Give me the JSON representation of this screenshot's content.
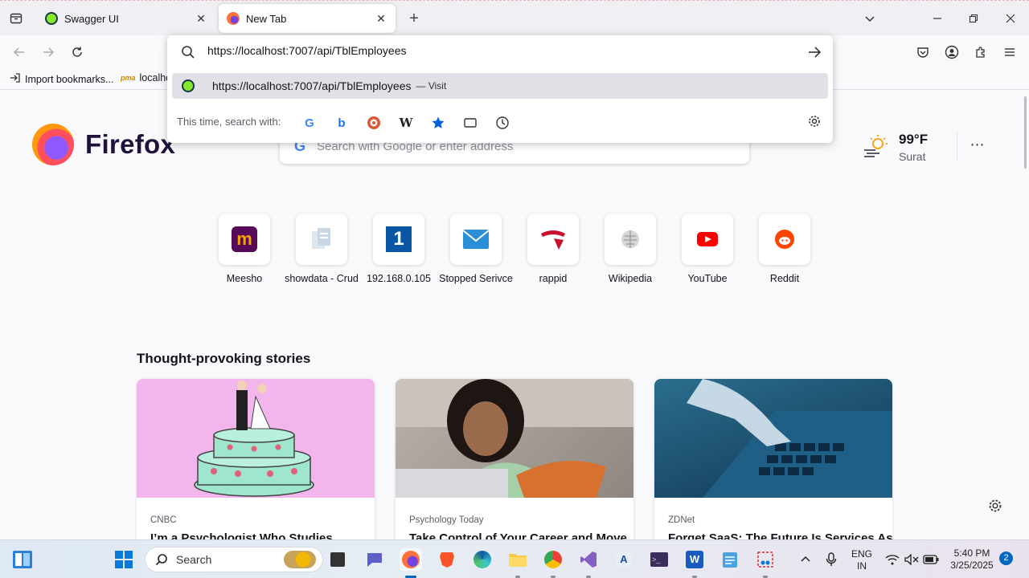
{
  "browser": {
    "tabs": [
      {
        "title": "Swagger UI",
        "icon": "swagger-icon",
        "active": false
      },
      {
        "title": "New Tab",
        "icon": "firefox-icon",
        "active": true
      }
    ],
    "new_tab_symbol": "+",
    "window_controls": [
      "chevron-down-icon",
      "minimize-icon",
      "restore-icon",
      "close-icon"
    ]
  },
  "bookmarks": [
    {
      "label": "Import bookmarks...",
      "icon": "import-icon"
    },
    {
      "label": "localho",
      "icon": "pma-icon"
    }
  ],
  "urlbar": {
    "value": "https://localhost:7007/api/TblEmployees",
    "suggestion_url": "https://localhost:7007/api/TblEmployees",
    "suggestion_action": "— Visit",
    "search_with_label": "This time, search with:",
    "engines": [
      "google-icon",
      "bing-icon",
      "duckduckgo-icon",
      "wikipedia-icon",
      "bookmarks-star-icon",
      "tabs-icon",
      "history-icon"
    ]
  },
  "newtab": {
    "brand": "Firefox",
    "search_placeholder": "Search with Google or enter address",
    "weather": {
      "temp": "99°F",
      "city": "Surat"
    },
    "shortcuts": [
      {
        "label": "Meesho"
      },
      {
        "label": "showdata - Crud"
      },
      {
        "label": "192.168.0.105"
      },
      {
        "label": "Stopped Serivce"
      },
      {
        "label": "rappid"
      },
      {
        "label": "Wikipedia"
      },
      {
        "label": "YouTube"
      },
      {
        "label": "Reddit"
      }
    ],
    "stories_title": "Thought-provoking stories",
    "stories": [
      {
        "source": "CNBC",
        "headline": "I’m a Psychologist Who Studies"
      },
      {
        "source": "Psychology Today",
        "headline": "Take Control of Your Career and Move"
      },
      {
        "source": "ZDNet",
        "headline": "Forget SaaS: The Future Is Services As"
      }
    ]
  },
  "taskbar": {
    "search_label": "Search",
    "language": [
      "ENG",
      "IN"
    ],
    "time": "5:40 PM",
    "date": "3/25/2025",
    "notification_count": "2"
  }
}
